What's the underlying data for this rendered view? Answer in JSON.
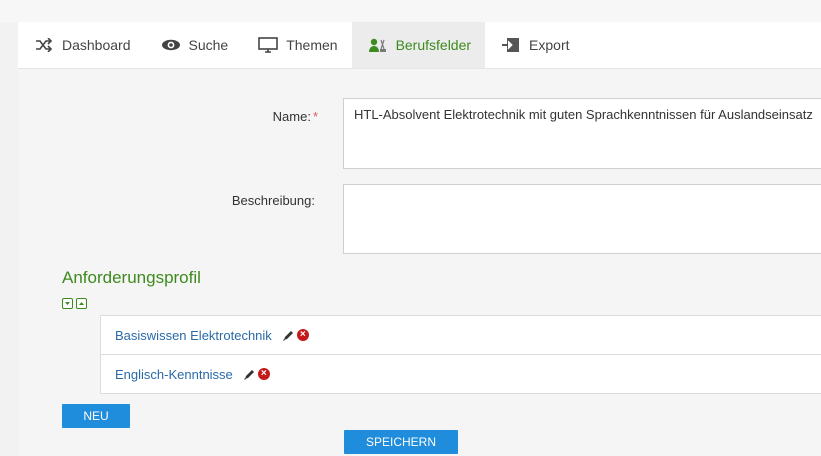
{
  "nav": {
    "items": [
      {
        "label": "Dashboard",
        "icon": "shuffle-icon"
      },
      {
        "label": "Suche",
        "icon": "eye-icon"
      },
      {
        "label": "Themen",
        "icon": "monitor-icon"
      },
      {
        "label": "Berufsfelder",
        "icon": "worker-icon",
        "active": true
      },
      {
        "label": "Export",
        "icon": "export-icon"
      }
    ]
  },
  "form": {
    "name_label": "Name:",
    "required_mark": "*",
    "name_value": "HTL-Absolvent Elektrotechnik mit guten Sprachkenntnissen für Auslandseinsatz",
    "description_label": "Beschreibung:",
    "description_value": ""
  },
  "profile": {
    "title": "Anforderungsprofil",
    "items": [
      {
        "label": "Basiswissen Elektrotechnik"
      },
      {
        "label": "Englisch-Kenntnisse"
      }
    ],
    "new_button": "NEU"
  },
  "save_button": "SPEICHERN",
  "colors": {
    "accent_green": "#3d8a1e",
    "button_blue": "#1f8ddb",
    "link_blue": "#2a6aa8",
    "delete_red": "#c41a1a"
  }
}
